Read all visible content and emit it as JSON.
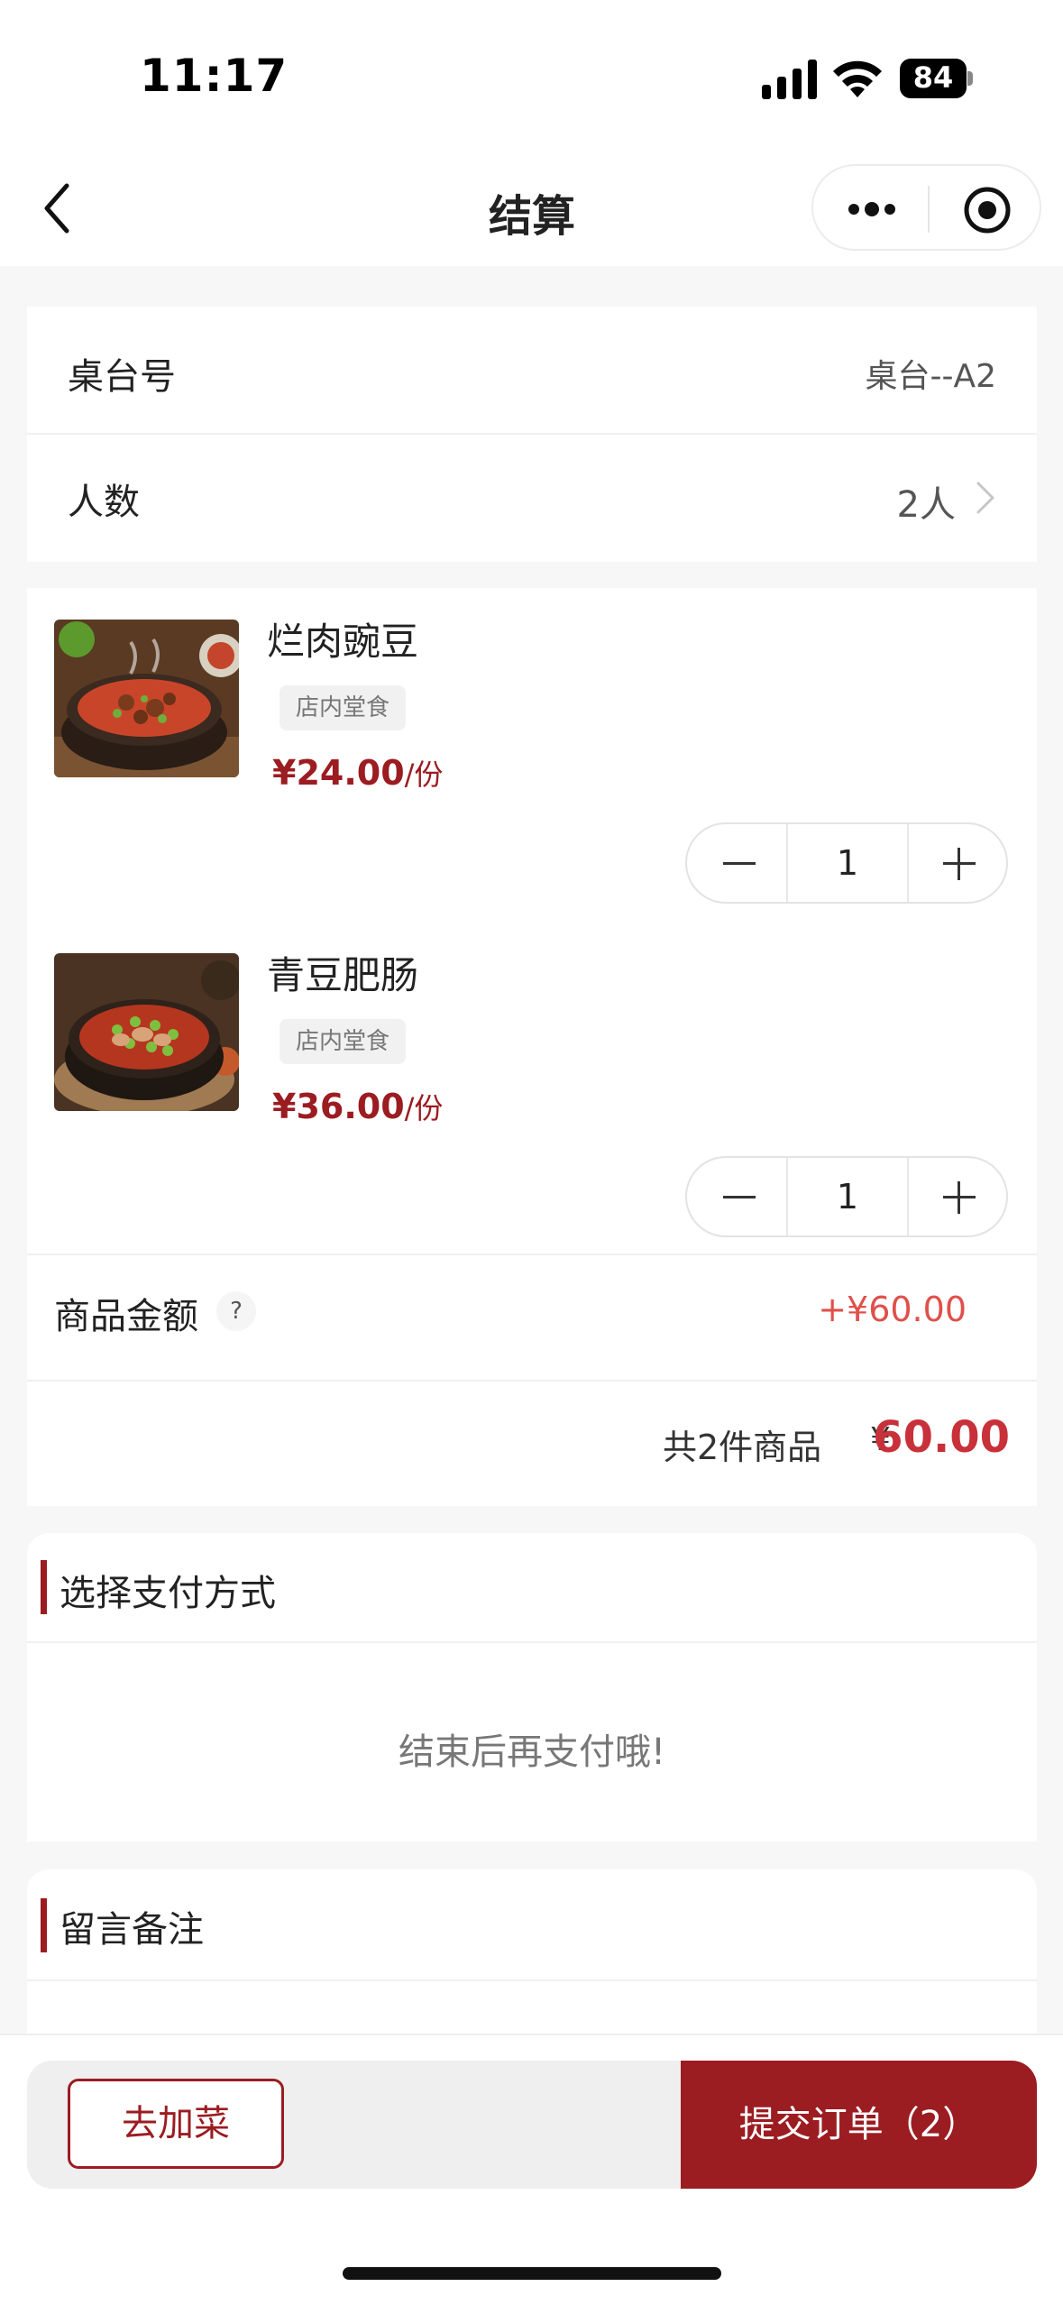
{
  "status_bar": {
    "time": "11:17",
    "battery": "84"
  },
  "nav": {
    "title": "结算"
  },
  "table": {
    "label": "桌台号",
    "value": "桌台--A2"
  },
  "guests": {
    "label": "人数",
    "value": "2人"
  },
  "items": [
    {
      "name": "烂肉豌豆",
      "tag": "店内堂食",
      "price": "¥24.00",
      "unit": "/份",
      "qty": "1"
    },
    {
      "name": "青豆肥肠",
      "tag": "店内堂食",
      "price": "¥36.00",
      "unit": "/份",
      "qty": "1"
    }
  ],
  "summary": {
    "amount_label": "商品金额",
    "help": "?",
    "amount_value": "+¥60.00",
    "count_text": "共2件商品",
    "currency": "¥",
    "total": "60.00"
  },
  "payment": {
    "title": "选择支付方式",
    "note": "结束后再支付哦!"
  },
  "remark": {
    "title": "留言备注"
  },
  "bottom": {
    "add_label": "去加菜",
    "submit_label": "提交订单（2）"
  },
  "colors": {
    "accent": "#9b1c21",
    "amount_red": "#e0504b"
  }
}
